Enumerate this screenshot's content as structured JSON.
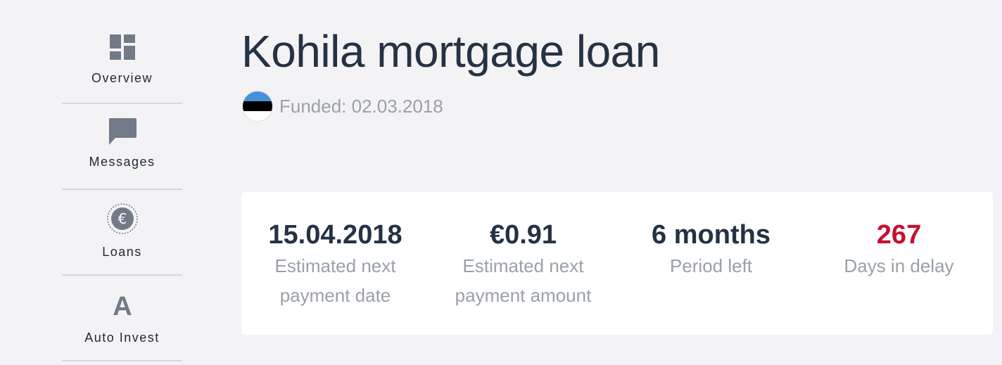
{
  "sidebar": {
    "items": [
      {
        "label": "Overview",
        "icon": "dashboard-icon"
      },
      {
        "label": "Messages",
        "icon": "message-icon"
      },
      {
        "label": "Loans",
        "icon": "euro-coin-icon"
      },
      {
        "label": "Auto Invest",
        "icon": "auto-invest-icon"
      }
    ]
  },
  "loan": {
    "title": "Kohila mortgage loan",
    "funded": "Funded: 02.03.2018",
    "flag_colors": [
      "#4891d9",
      "#000000",
      "#ffffff"
    ]
  },
  "stats": [
    {
      "value": "15.04.2018",
      "label_line1": "Estimated next",
      "label_line2": "payment date"
    },
    {
      "value": "€0.91",
      "label_line1": "Estimated next",
      "label_line2": "payment amount"
    },
    {
      "value": "6 months",
      "label_line1": "Period left",
      "label_line2": ""
    },
    {
      "value": "267",
      "label_line1": "Days in delay",
      "label_line2": "",
      "color": "#c8102e"
    }
  ],
  "colors": {
    "text_dark": "#253244",
    "text_muted": "#9aa0a9",
    "delay_red": "#c8102e",
    "icon_gray": "#727a87"
  }
}
